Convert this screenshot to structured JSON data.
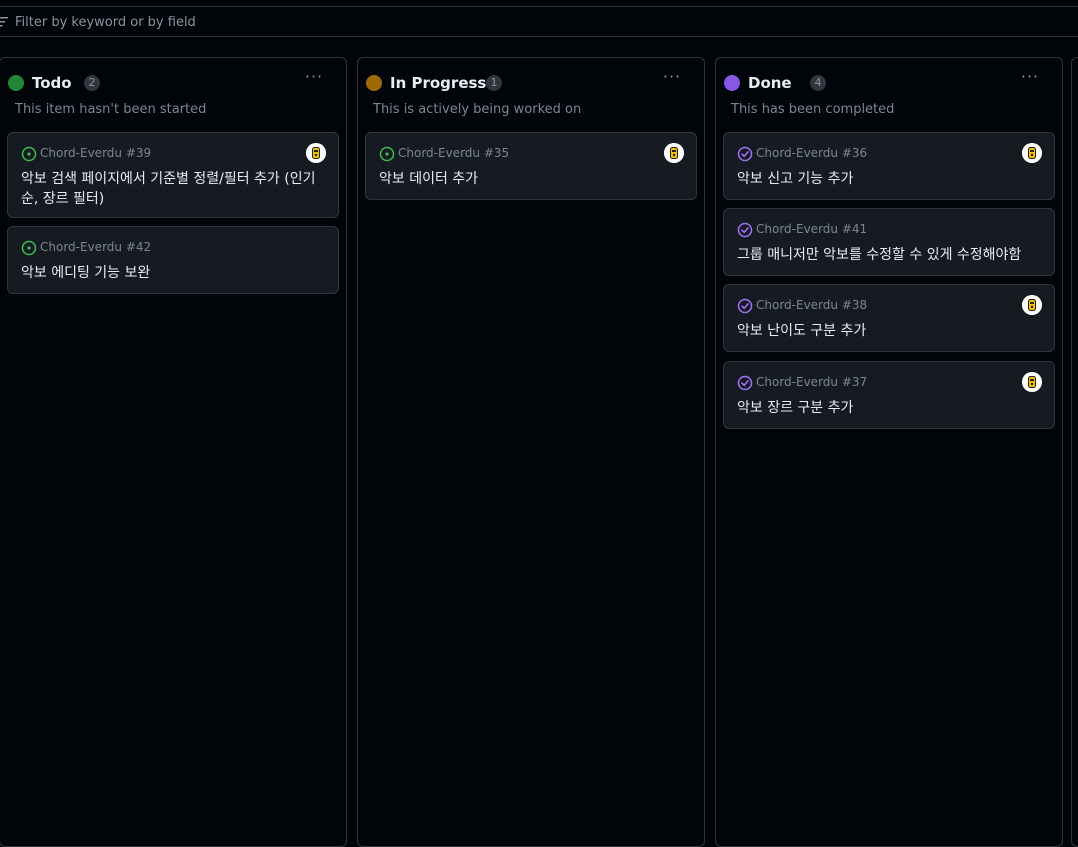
{
  "filter": {
    "placeholder": "Filter by keyword or by field"
  },
  "columns": [
    {
      "title": "Todo",
      "count": "2",
      "color": "#238636",
      "description": "This item hasn't been started",
      "cards": [
        {
          "repo": "Chord-Everdu #39",
          "title": "악보 검색 페이지에서 기준별 정렬/필터 추가 (인기순, 장르 필터)",
          "status": "open",
          "has_avatar": true
        },
        {
          "repo": "Chord-Everdu #42",
          "title": "악보 에디팅 기능 보완",
          "status": "open",
          "has_avatar": false
        }
      ]
    },
    {
      "title": "In Progress",
      "count": "1",
      "color": "#9e6a03",
      "description": "This is actively being worked on",
      "cards": [
        {
          "repo": "Chord-Everdu #35",
          "title": "악보 데이터 추가",
          "status": "open",
          "has_avatar": true
        }
      ]
    },
    {
      "title": "Done",
      "count": "4",
      "color": "#8957e5",
      "description": "This has been completed",
      "cards": [
        {
          "repo": "Chord-Everdu #36",
          "title": "악보 신고 기능 추가",
          "status": "closed",
          "has_avatar": true
        },
        {
          "repo": "Chord-Everdu #41",
          "title": "그룹 매니저만 악보를 수정할 수 있게 수정해야함",
          "status": "closed",
          "has_avatar": false
        },
        {
          "repo": "Chord-Everdu #38",
          "title": "악보 난이도 구분 추가",
          "status": "closed",
          "has_avatar": true
        },
        {
          "repo": "Chord-Everdu #37",
          "title": "악보 장르 구분 추가",
          "status": "closed",
          "has_avatar": true
        }
      ]
    }
  ],
  "icons": {
    "open": "issue-opened-icon",
    "closed": "issue-closed-icon",
    "filter": "filter-icon",
    "menu": "kebab-menu-icon",
    "avatar": "user-avatar-icon"
  },
  "colors": {
    "open_icon": "#3fb950",
    "closed_icon": "#a371f7"
  }
}
